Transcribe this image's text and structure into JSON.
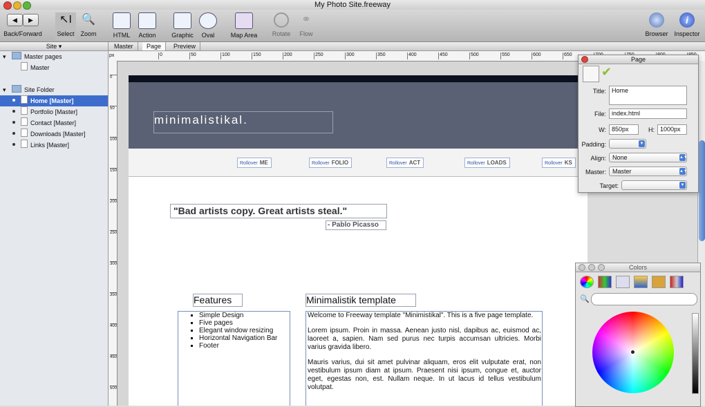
{
  "window": {
    "title": "My Photo Site.freeway"
  },
  "toolbar": [
    {
      "label": "Back/Forward"
    },
    {
      "label": "Select"
    },
    {
      "label": "Zoom"
    },
    {
      "label": "HTML"
    },
    {
      "label": "Action"
    },
    {
      "label": "Graphic"
    },
    {
      "label": "Oval"
    },
    {
      "label": "Map Area"
    },
    {
      "label": "Rotate"
    },
    {
      "label": "Flow"
    },
    {
      "label": "Browser"
    },
    {
      "label": "Inspector"
    }
  ],
  "sidebar": {
    "header": "Site",
    "master_section": "Master pages",
    "master_item": "Master",
    "site_section": "Site Folder",
    "pages": [
      "Home [Master]",
      "Portfolio [Master]",
      "Contact [Master]",
      "Downloads [Master]",
      "Links [Master]"
    ]
  },
  "view_tabs": [
    "Master",
    "Page",
    "Preview"
  ],
  "ruler": {
    "unit": "px",
    "ticks": [
      "0",
      "50",
      "100",
      "150",
      "200",
      "250",
      "300",
      "350",
      "400",
      "450",
      "500",
      "550",
      "600",
      "650",
      "700",
      "750",
      "800",
      "850"
    ]
  },
  "page": {
    "site_title": "minimalistikal.",
    "nav": [
      {
        "rollover": "Rollover",
        "label": "ME"
      },
      {
        "rollover": "Rollover",
        "label": "FOLIO"
      },
      {
        "rollover": "Rollover",
        "label": "ACT"
      },
      {
        "rollover": "Rollover",
        "label": "LOADS"
      },
      {
        "rollover": "Rollover",
        "label": "KS"
      }
    ],
    "quote": "\"Bad artists copy. Great artists steal.\"",
    "author": "- Pablo Picasso",
    "features_heading": "Features",
    "features": [
      "Simple Design",
      "Five pages",
      "Elegant window resizing",
      "Horizontal Navigation Bar",
      "Footer"
    ],
    "template_heading": "Minimalistik template",
    "paragraphs": [
      "Welcome to Freeway template \"Minimistikal\". This is a five page template.",
      "Lorem ipsum. Proin in massa. Aenean justo nisl, dapibus ac, euismod ac, laoreet a, sapien. Nam sed purus nec turpis accumsan ultricies. Morbi varius gravida libero.",
      "Mauris varius, dui sit amet pulvinar aliquam, eros elit vulputate erat, non vestibulum ipsum diam at ipsum. Praesent nisi ipsum, congue et, auctor eget, egestas non, est. Nullam neque. In ut lacus id tellus vestibulum volutpat."
    ]
  },
  "inspector": {
    "title": "Page",
    "title_label": "Title:",
    "title_value": "Home",
    "file_label": "File:",
    "file_value": "index.html",
    "w_label": "W:",
    "w_value": "850px",
    "h_label": "H:",
    "h_value": "1000px",
    "padding_label": "Padding:",
    "align_label": "Align:",
    "align_value": "None",
    "master_label": "Master:",
    "master_value": "Master",
    "target_label": "Target:"
  },
  "colors_panel": {
    "title": "Colors"
  },
  "colors": {
    "header_bg": "#5a6174",
    "selection": "#3d6dcc",
    "topbar": "#0c0f1e"
  }
}
